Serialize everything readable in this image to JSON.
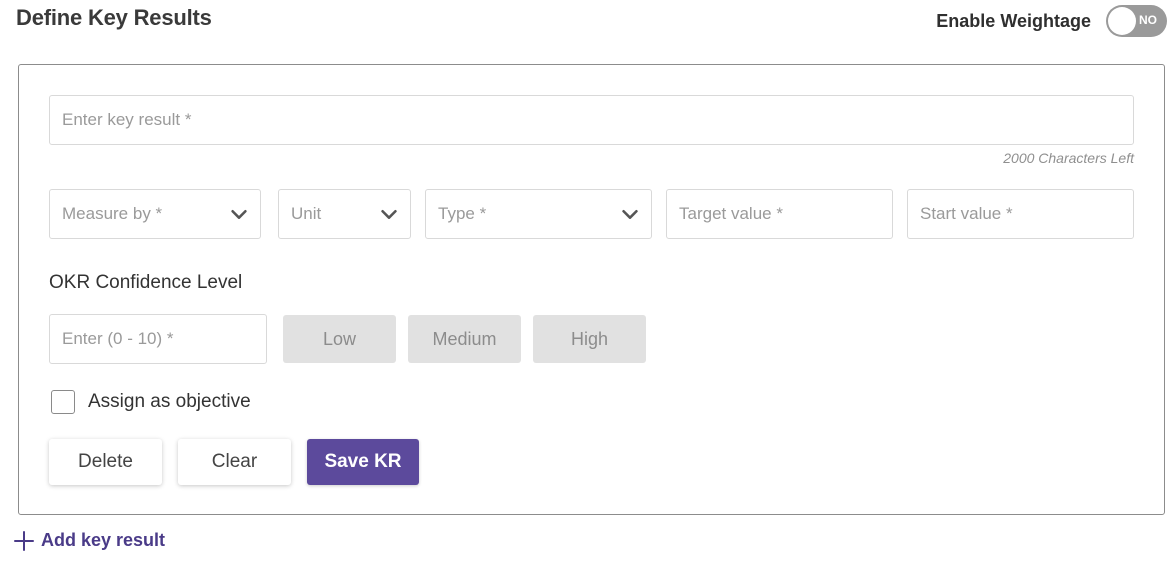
{
  "header": {
    "title": "Define Key Results",
    "weightage_label": "Enable Weightage",
    "toggle_text": "NO"
  },
  "key_result": {
    "placeholder": "Enter key result *",
    "value": "",
    "char_count": "2000 Characters Left"
  },
  "fields": {
    "measure_by": "Measure by *",
    "unit": "Unit",
    "type": "Type *",
    "target_placeholder": "Target value *",
    "start_placeholder": "Start value *"
  },
  "confidence": {
    "label": "OKR Confidence Level",
    "placeholder": "Enter (0 - 10) *",
    "levels": [
      "Low",
      "Medium",
      "High"
    ]
  },
  "assign": {
    "label": "Assign as objective",
    "checked": false
  },
  "actions": {
    "delete": "Delete",
    "clear": "Clear",
    "save": "Save KR"
  },
  "add_key_result": "Add key result",
  "colors": {
    "accent": "#5c4a9c",
    "toggle_off": "#9a9a9a",
    "level_bg": "#e1e1e1"
  },
  "icons": {
    "dropdown": "chevron-down-icon",
    "add": "plus-icon"
  }
}
